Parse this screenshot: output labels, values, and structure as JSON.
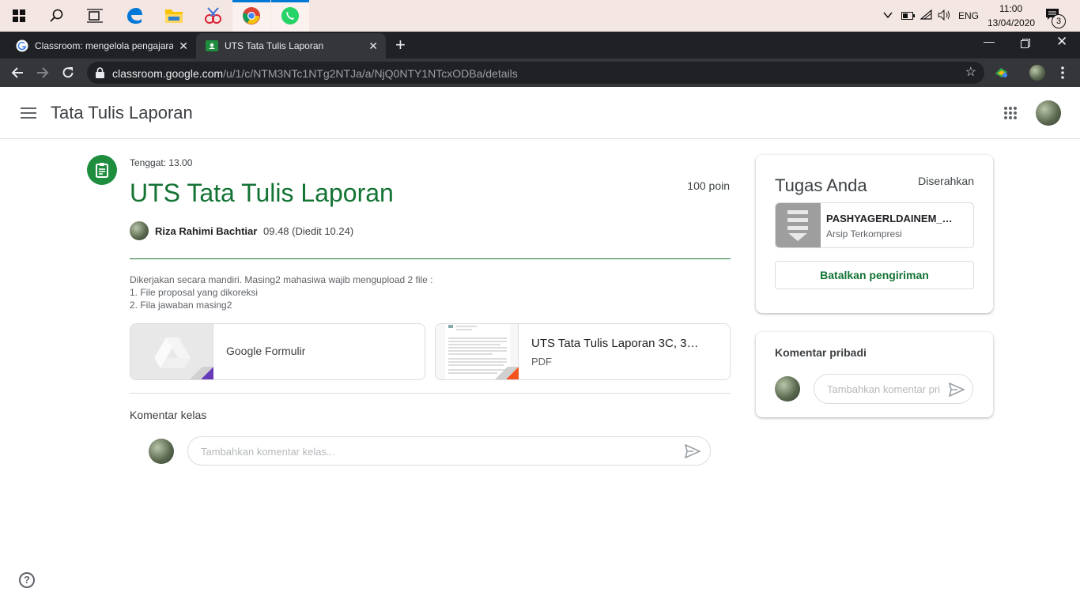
{
  "taskbar": {
    "icons": [
      "windows-start-icon",
      "search-icon",
      "task-view-icon",
      "edge-icon",
      "file-explorer-icon",
      "snipping-tool-icon",
      "chrome-icon",
      "whatsapp-icon"
    ],
    "language": "ENG",
    "time": "11:00",
    "date": "13/04/2020",
    "notification_count": "3"
  },
  "browser": {
    "tabs": [
      {
        "title": "Classroom: mengelola pengajaran",
        "active": false
      },
      {
        "title": "UTS Tata Tulis Laporan",
        "active": true
      }
    ],
    "url_host": "classroom.google.com",
    "url_path": "/u/1/c/NTM3NTc1NTg2NTJa/a/NjQ0NTY1NTcxODBa/details"
  },
  "header": {
    "class_name": "Tata Tulis Laporan"
  },
  "assignment": {
    "due": "Tenggat: 13.00",
    "title": "UTS Tata Tulis Laporan",
    "points": "100 poin",
    "author": "Riza Rahimi Bachtiar",
    "posted": "09.48 (Diedit 10.24)",
    "description": [
      "Dikerjakan secara mandiri. Masing2 mahasiwa wajib mengupload 2 file :",
      "1. File proposal yang dikoreksi",
      "2. Fila jawaban masing2"
    ],
    "attachments": [
      {
        "name": "Google Formulir",
        "type": ""
      },
      {
        "name": "UTS Tata Tulis Laporan 3C, 3…",
        "type": "PDF"
      }
    ]
  },
  "class_comments": {
    "heading": "Komentar kelas",
    "placeholder": "Tambahkan komentar kelas..."
  },
  "your_work": {
    "title": "Tugas Anda",
    "status": "Diserahkan",
    "file_name": "PASHYAGERLDAINEM_…",
    "file_type": "Arsip Terkompresi",
    "unsubmit_label": "Batalkan pengiriman"
  },
  "private_comments": {
    "heading": "Komentar pribadi",
    "placeholder": "Tambahkan komentar pri"
  },
  "colors": {
    "accent_green": "#137333",
    "chrome_dark": "#202124",
    "taskbar": "#f4e6e3"
  }
}
